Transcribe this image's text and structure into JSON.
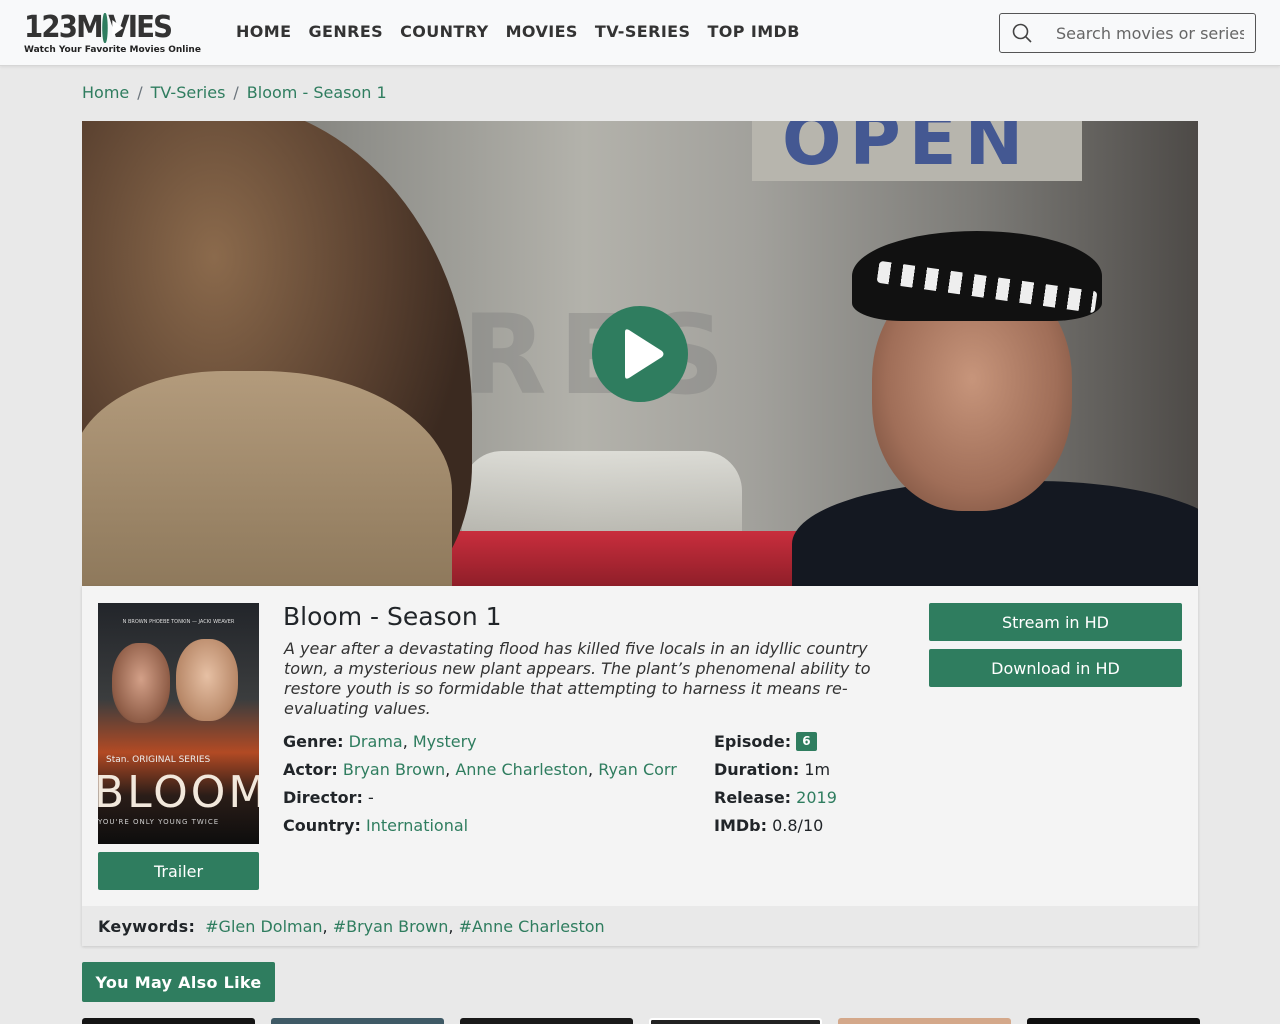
{
  "header": {
    "logo_text_left": "123M",
    "logo_text_right": "VIES",
    "logo_tagline": "Watch Your Favorite Movies Online",
    "nav": [
      "HOME",
      "GENRES",
      "COUNTRY",
      "MOVIES",
      "TV-SERIES",
      "TOP IMDB"
    ],
    "search_placeholder": "Search movies or series"
  },
  "breadcrumb": [
    "Home",
    "TV-Series",
    "Bloom - Season 1"
  ],
  "player": {
    "sign_text": "OPEN",
    "window_letters": "RES"
  },
  "show": {
    "title": "Bloom - Season 1",
    "description": "A year after a devastating flood has killed five locals in an idyllic country town, a mysterious new plant appears. The plant’s phenomenal ability to restore youth is so formidable that attempting to harness it means re-evaluating values.",
    "genre_label": "Genre:",
    "genres": [
      "Drama",
      "Mystery"
    ],
    "actor_label": "Actor:",
    "actors": [
      "Bryan Brown",
      "Anne Charleston",
      "Ryan Corr"
    ],
    "director_label": "Director:",
    "director": "-",
    "country_label": "Country:",
    "country": "International",
    "episode_label": "Episode:",
    "episode": "6",
    "duration_label": "Duration:",
    "duration": "1m",
    "release_label": "Release:",
    "release": "2019",
    "imdb_label": "IMDb:",
    "imdb": "0.8/10"
  },
  "poster": {
    "credits": "N BROWN   PHOEBE TONKIN  —  JACKI WEAVER",
    "stan_line": "Stan. ORIGINAL SERIES",
    "title": "BLOOM",
    "tagline": "YOU'RE ONLY YOUNG TWICE"
  },
  "buttons": {
    "trailer": "Trailer",
    "stream": "Stream in HD",
    "download": "Download in HD"
  },
  "keywords": {
    "label": "Keywords:",
    "items": [
      "#Glen Dolman",
      "#Bryan Brown",
      "#Anne Charleston"
    ]
  },
  "also_like": "You May Also Like",
  "colors": {
    "accent": "#2f7d5f",
    "background": "#e9e9e9",
    "header_bg": "#f8f9fa"
  }
}
